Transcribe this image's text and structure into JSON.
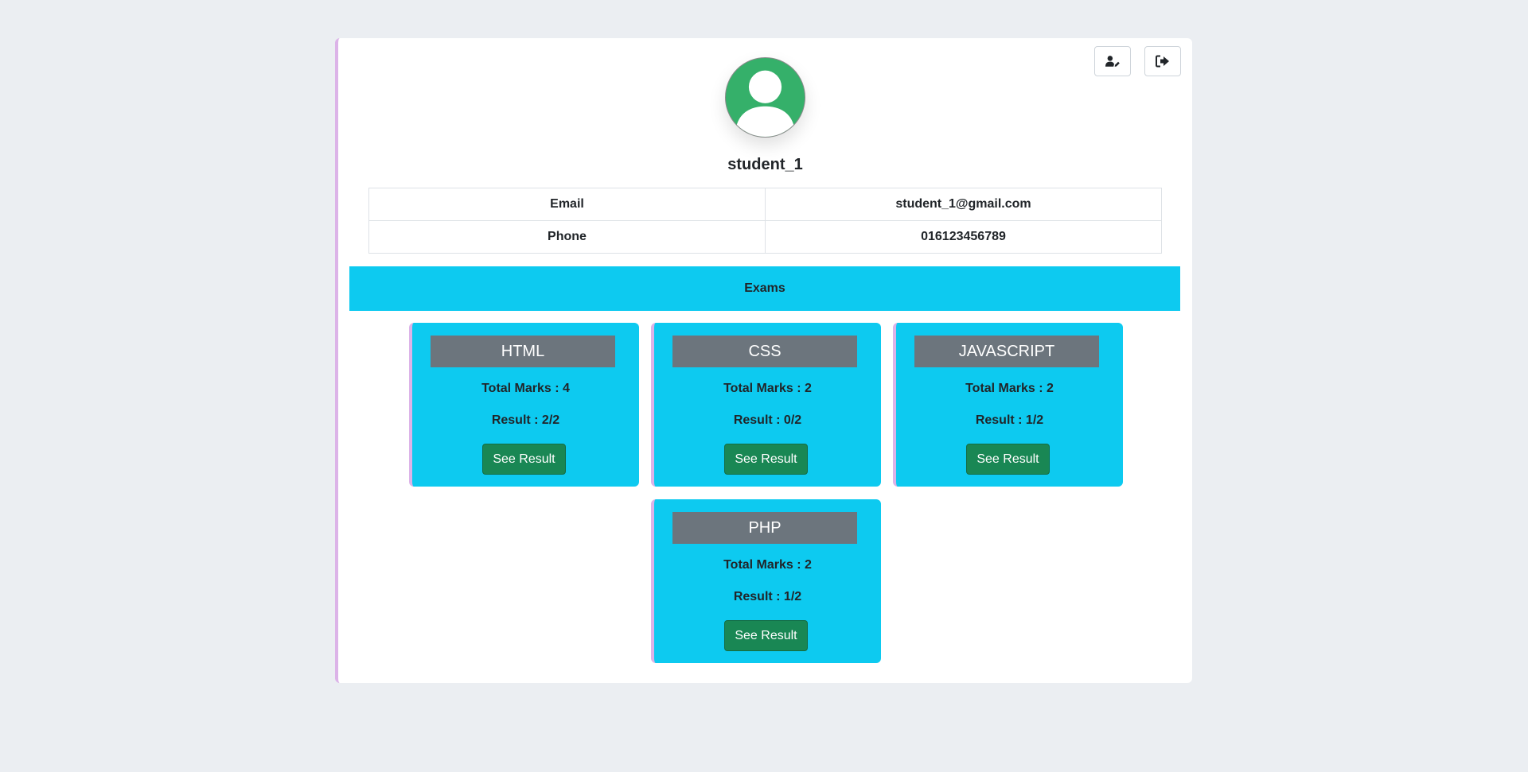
{
  "profile": {
    "username": "student_1",
    "email_label": "Email",
    "email_value": "student_1@gmail.com",
    "phone_label": "Phone",
    "phone_value": "016123456789"
  },
  "toolbar": {
    "edit_icon": "user-edit-icon",
    "logout_icon": "sign-out-icon"
  },
  "exams": {
    "header": "Exams",
    "cards": [
      {
        "subject": "HTML",
        "total_marks": "Total Marks : 4",
        "result": "Result : 2/2",
        "button": "See Result"
      },
      {
        "subject": "CSS",
        "total_marks": "Total Marks : 2",
        "result": "Result : 0/2",
        "button": "See Result"
      },
      {
        "subject": "JAVASCRIPT",
        "total_marks": "Total Marks : 2",
        "result": "Result : 1/2",
        "button": "See Result"
      },
      {
        "subject": "PHP",
        "total_marks": "Total Marks : 2",
        "result": "Result : 1/2",
        "button": "See Result"
      }
    ]
  },
  "colors": {
    "page_bg": "#ebeef2",
    "accent_cyan": "#0dcaf0",
    "card_title_gray": "#6c757d",
    "button_green": "#198754",
    "avatar_green": "#35b06a",
    "accent_border": "#dcb3e8"
  }
}
